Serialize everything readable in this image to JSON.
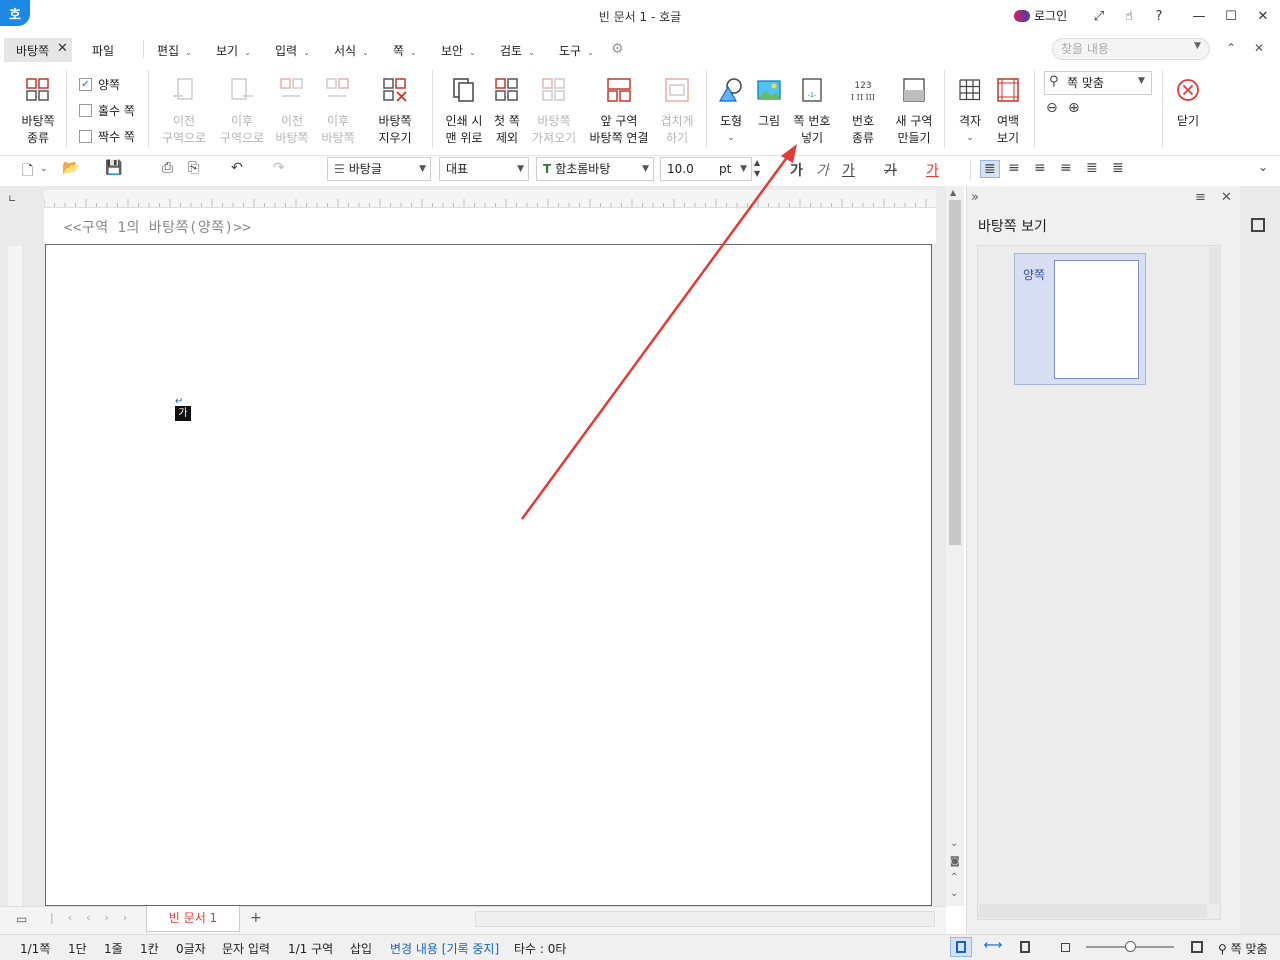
{
  "window": {
    "title": "빈 문서 1 - 호글",
    "app_icon": "호",
    "login_label": "로그인"
  },
  "menubar": {
    "active_tab": "바탕쪽",
    "items": [
      "파일",
      "편집",
      "보기",
      "입력",
      "서식",
      "쪽",
      "보안",
      "검토",
      "도구"
    ],
    "find_placeholder": "찾을 내용"
  },
  "ribbon": {
    "master_type": "바탕쪽\n종류",
    "checkboxes": [
      {
        "label": "양쪽",
        "checked": true
      },
      {
        "label": "홀수 쪽",
        "checked": false
      },
      {
        "label": "짝수 쪽",
        "checked": false
      }
    ],
    "prev_section": "이전\n구역으로",
    "next_section": "이후\n구역으로",
    "prev_master": "이전\n바탕쪽",
    "next_master": "이후\n바탕쪽",
    "delete_master": "바탕쪽\n지우기",
    "print_on_top": "인쇄 시\n맨 위로",
    "exclude_first": "첫 쪽\n제외",
    "import_master": "바탕쪽\n가져오기",
    "link_prev": "앞 구역\n바탕쪽 연결",
    "overlap": "겹치게\n하기",
    "shape": "도형",
    "picture": "그림",
    "page_number": "쪽 번호\n넣기",
    "number_type": "번호\n종류",
    "new_section": "새 구역\n만들기",
    "grid": "격자",
    "margin_view": "여백\n보기",
    "zoom_value": "쪽 맞춤",
    "close": "닫기"
  },
  "toolbar": {
    "style": "바탕글",
    "lang": "대표",
    "font": "함초롬바탕",
    "size": "10.0",
    "unit": "pt"
  },
  "document": {
    "section_label": "<<구역 1의 바탕쪽(양쪽)>>",
    "cursor_char": "가",
    "tab_name": "빈 문서 1"
  },
  "side_panel": {
    "title": "바탕쪽 보기",
    "thumb_label": "양쪽"
  },
  "statusbar": {
    "page": "1/1쪽",
    "column": "1단",
    "line": "1줄",
    "col": "1칸",
    "chars": "0글자",
    "mode": "문자 입력",
    "section": "1/1 구역",
    "insert": "삽입",
    "track": "변경 내용 [기록 중지]",
    "typing": "타수 : 0타",
    "zoom": "쪽 맞춤"
  },
  "colors": {
    "accent": "#1e88e5",
    "arrow": "#e53935",
    "doc_tab": "#e53935"
  }
}
